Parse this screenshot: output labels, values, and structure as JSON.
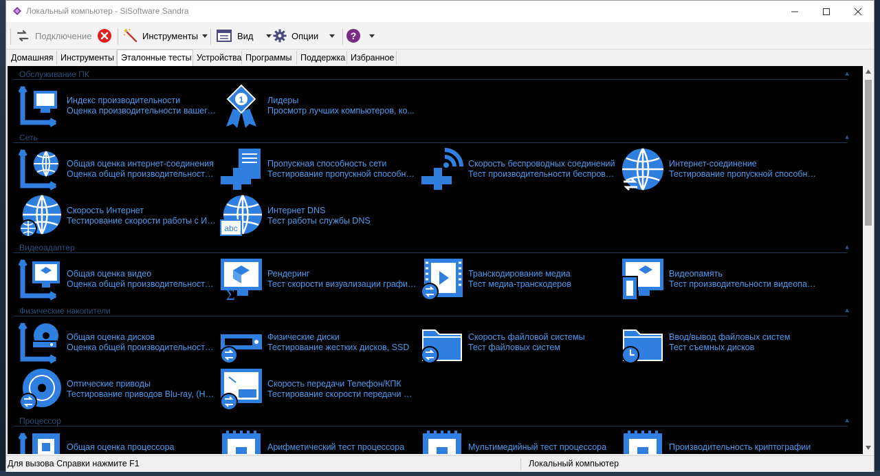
{
  "window": {
    "title": "Локальный компьютер - SiSoftware Sandra"
  },
  "toolbar": {
    "connect_label": "Подключение",
    "tools_label": "Инструменты",
    "view_label": "Вид",
    "options_label": "Опции"
  },
  "tabs": [
    "Домашняя",
    "Инструменты",
    "Эталонные тесты",
    "Устройства",
    "Программы",
    "Поддержка",
    "Избранное"
  ],
  "active_tab": "Эталонные тесты",
  "sections": [
    {
      "title": "Обслуживание ПК"
    },
    {
      "title": "Сеть"
    },
    {
      "title": "Видеоадаптер"
    },
    {
      "title": "Физические накопители"
    },
    {
      "title": "Процессор"
    }
  ],
  "items": [
    {
      "title": "Индекс производительности",
      "desc": "Оценка производительности вашего ...",
      "icon": "performance-index-icon"
    },
    {
      "title": "Лидеры",
      "desc": "Просмотр лучших компьютеров, ко...",
      "icon": "leaders-medal-icon"
    },
    {
      "title": "Общая оценка интернет-соединения",
      "desc": "Оценка общей производительности ...",
      "icon": "internet-overall-icon"
    },
    {
      "title": "Пропускная способность сети",
      "desc": "Тестирование пропускной способно...",
      "icon": "network-bandwidth-icon"
    },
    {
      "title": "Скорость беспроводных соединений",
      "desc": "Тест производительности беспровод...",
      "icon": "wireless-speed-icon"
    },
    {
      "title": "Интернет-соединение",
      "desc": "Тестирование пропускной способнос...",
      "icon": "internet-connection-icon"
    },
    {
      "title": "Скорость Интернет",
      "desc": "Тестирование скорости работы с Инт...",
      "icon": "internet-speed-icon"
    },
    {
      "title": "Интернет DNS",
      "desc": "Тест работы службы DNS",
      "icon": "internet-dns-icon"
    },
    {
      "title": "Общая оценка видео",
      "desc": "Оценка общей производительности г...",
      "icon": "video-overall-icon"
    },
    {
      "title": "Рендеринг",
      "desc": "Тест скорости визуализации графиче...",
      "icon": "rendering-icon"
    },
    {
      "title": "Транскодирование медиа",
      "desc": "Тест медиа-транскодеров",
      "icon": "media-transcode-icon"
    },
    {
      "title": "Видеопамять",
      "desc": "Тест производительности видеопамяти",
      "icon": "video-memory-icon"
    },
    {
      "title": "Общая оценка дисков",
      "desc": "Оценка общей производительности д...",
      "icon": "disk-overall-icon"
    },
    {
      "title": "Физические диски",
      "desc": "Тестирование жестких дисков, SSD",
      "icon": "physical-disks-icon"
    },
    {
      "title": "Скорость файловой системы",
      "desc": "Тест файловых систем",
      "icon": "filesystem-speed-icon"
    },
    {
      "title": "Ввод/вывод файловых систем",
      "desc": "Тест съемных дисков",
      "icon": "filesystem-io-icon"
    },
    {
      "title": "Оптические приводы",
      "desc": "Тестирование приводов Blu-ray, (HD)...",
      "icon": "optical-drive-icon"
    },
    {
      "title": "Скорость передачи Телефон/КПК",
      "desc": "Тестирование скорости передачи мо...",
      "icon": "phone-transfer-icon"
    },
    {
      "title": "Общая оценка процессора",
      "desc": "",
      "icon": "cpu-overall-icon"
    },
    {
      "title": "Арифметический тест процессора",
      "desc": "",
      "icon": "cpu-arithmetic-icon"
    },
    {
      "title": "Мультимедийный тест процессора",
      "desc": "",
      "icon": "cpu-multimedia-icon"
    },
    {
      "title": "Производительность криптографии",
      "desc": "",
      "icon": "crypto-performance-icon"
    }
  ],
  "status": {
    "left": "Для вызова Справки нажмите F1",
    "right": "Локальный компьютер"
  }
}
